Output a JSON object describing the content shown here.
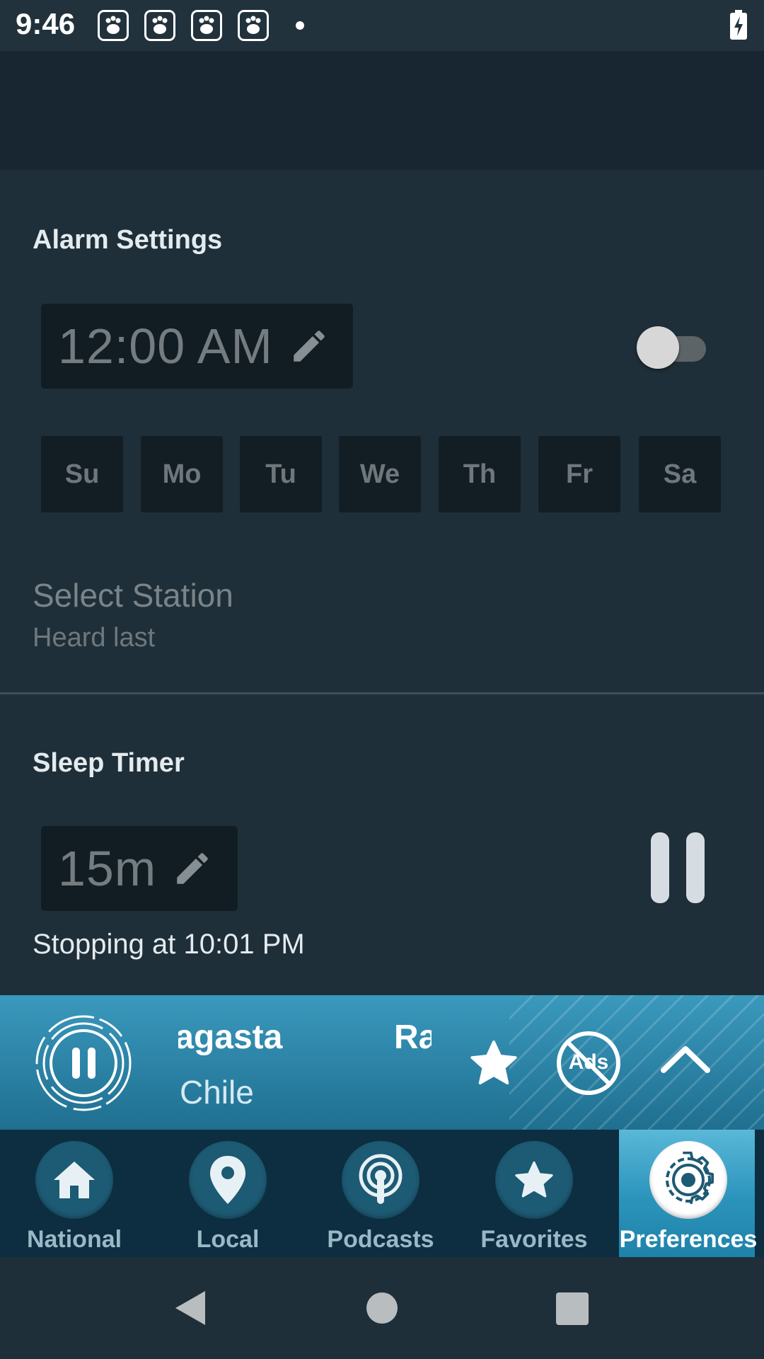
{
  "status_bar": {
    "time": "9:46",
    "notification_icons": [
      "baidu-paw-icon",
      "baidu-paw-icon",
      "baidu-paw-icon",
      "baidu-paw-icon"
    ],
    "battery": "battery-charging-icon"
  },
  "alarm": {
    "title": "Alarm Settings",
    "time": "12:00 AM",
    "enabled": false,
    "days": [
      "Su",
      "Mo",
      "Tu",
      "We",
      "Th",
      "Fr",
      "Sa"
    ],
    "select_station_label": "Select Station",
    "select_station_value": "Heard last"
  },
  "sleep_timer": {
    "title": "Sleep Timer",
    "duration": "15m",
    "stopping_text": "Stopping at 10:01 PM"
  },
  "player": {
    "station_text_a": "Antofagasta",
    "station_text_b": "Ra",
    "station_sub": "Chile",
    "ads_label": "Ads"
  },
  "tabs": [
    {
      "label": "National",
      "icon": "home-icon"
    },
    {
      "label": "Local",
      "icon": "location-pin-icon"
    },
    {
      "label": "Podcasts",
      "icon": "podcast-icon"
    },
    {
      "label": "Favorites",
      "icon": "star-icon"
    },
    {
      "label": "Preferences",
      "icon": "gear-icon",
      "active": true
    }
  ],
  "colors": {
    "background": "#1f2f39",
    "player_accent": "#2f88ad",
    "tab_bar": "#0c2e40"
  }
}
